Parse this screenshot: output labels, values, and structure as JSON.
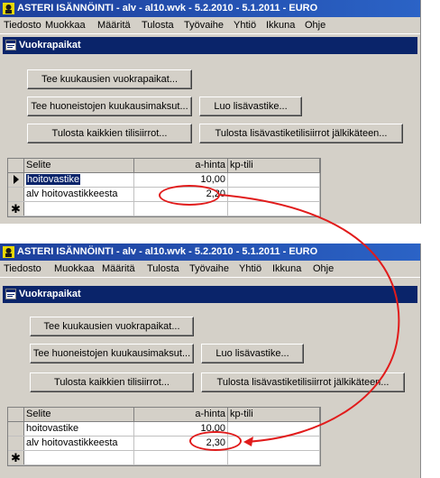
{
  "app": {
    "title": "ASTERI ISÄNNÖINTI - alv - al10.wvk - 5.2.2010 - 5.1.2011 - EURO",
    "menu": [
      "Tiedosto",
      "Muokkaa",
      "Määritä",
      "Tulosta",
      "Työvaihe",
      "Yhtiö",
      "Ikkuna",
      "Ohje"
    ]
  },
  "window": {
    "title": "Vuokrapaikat",
    "buttons": {
      "monthly": "Tee kuukausien vuokrapaikat...",
      "room_fees": "Tee huoneistojen kuukausimaksut...",
      "create_addon": "Luo lisävastike...",
      "print_all": "Tulosta kaikkien tilisiirrot...",
      "print_addon": "Tulosta lisävastiketilisiirrot jälkikäteen..."
    },
    "grid_headers": {
      "description": "Selite",
      "price": "a-hinta",
      "account": "kp-tili"
    }
  },
  "before": {
    "rows": [
      {
        "description": "hoitovastike",
        "price": "10,00",
        "account": ""
      },
      {
        "description": "alv hoitovastikkeesta",
        "price": "2,20",
        "account": ""
      }
    ]
  },
  "after": {
    "rows": [
      {
        "description": "hoitovastike",
        "price": "10,00",
        "account": ""
      },
      {
        "description": "alv hoitovastikkeesta",
        "price": "2,30",
        "account": ""
      }
    ]
  },
  "icons": {
    "app": "asteri-app-icon",
    "window": "window-icon",
    "row_pointer": "row-pointer-icon",
    "new_row": "new-row-asterisk-icon"
  },
  "colors": {
    "titlebar": "#1d3f9b",
    "child_title": "#0a246a",
    "annotation": "#e11b1b",
    "selection": "#0a246a"
  }
}
